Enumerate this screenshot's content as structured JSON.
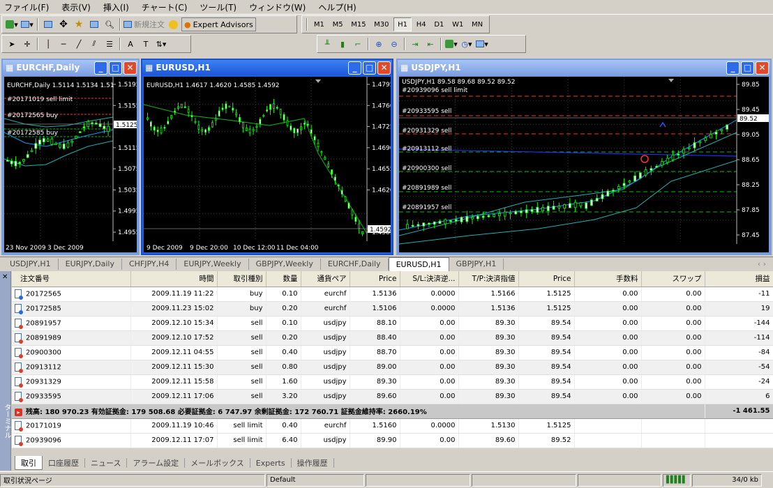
{
  "menu": [
    "ファイル(F)",
    "表示(V)",
    "挿入(I)",
    "チャート(C)",
    "ツール(T)",
    "ウィンドウ(W)",
    "ヘルプ(H)"
  ],
  "toolbar": {
    "new_order": "新規注文",
    "expert_advisors": "Expert Advisors",
    "timeframes": [
      "M1",
      "M5",
      "M15",
      "M30",
      "H1",
      "H4",
      "D1",
      "W1",
      "MN"
    ],
    "active_timeframe": "H1"
  },
  "colors": {
    "bull": "#00ff00",
    "bear": "#ffffff",
    "sell_line": "#ff3030",
    "buy_line": "#00c000",
    "ma": "#00a0ff",
    "band": "#20b0b0"
  },
  "windows": [
    {
      "title": "EURCHF,Daily",
      "info": "EURCHF,Daily  1.5114 1.5134 1.51",
      "orders": [
        "#20171019 sell limit",
        "#20172565 buy",
        "#20172585 buy"
      ],
      "prices": [
        "1.5195",
        "1.5155",
        "1.5125",
        "1.5115",
        "1.5075",
        "1.5035",
        "1.4995",
        "1.4955"
      ],
      "bid": "1.5125",
      "dates": [
        "23 Nov 2009",
        "3 Dec 2009"
      ]
    },
    {
      "title": "EURUSD,H1",
      "info": "EURUSD,H1  1.4617 1.4620 1.4585 1.4592",
      "prices": [
        "1.4795",
        "1.4760",
        "1.4725",
        "1.4690",
        "1.4655",
        "1.4620",
        "1.4592",
        "1.4585"
      ],
      "bid": "1.4592",
      "dates": [
        "9 Dec 2009",
        "9 Dec 20:00",
        "10 Dec 12:00",
        "11 Dec 04:00"
      ]
    },
    {
      "title": "USDJPY,H1",
      "info": "USDJPY,H1  89.58 89.68 89.52 89.52",
      "orders": [
        "#20939096 sell limit",
        "#20933595 sell",
        "#20931329 sell",
        "#20913112 sell",
        "#20900300 sell",
        "#20891989 sell",
        "#20891957 sell"
      ],
      "prices": [
        "89.85",
        "89.45",
        "89.05",
        "88.65",
        "88.25",
        "87.85",
        "87.45"
      ],
      "bid": "89.52"
    }
  ],
  "chart_tabs": [
    "USDJPY,H1",
    "EURJPY,Daily",
    "CHFJPY,H4",
    "EURJPY,Weekly",
    "GBPJPY,Weekly",
    "EURCHF,Daily",
    "EURUSD,H1",
    "GBPJPY,H1"
  ],
  "active_chart_tab": "EURUSD,H1",
  "columns": [
    "注文番号",
    "時間",
    "取引種別",
    "数量",
    "通貨ペア",
    "Price",
    "S/L:決済逆...",
    "T/P:決済指値",
    "Price",
    "手数料",
    "スワップ",
    "損益"
  ],
  "orders": [
    {
      "id": "20172565",
      "time": "2009.11.19 11:22",
      "type": "buy",
      "lots": "0.10",
      "symbol": "eurchf",
      "price": "1.5136",
      "sl": "0.0000",
      "tp": "1.5166",
      "cur": "1.5125",
      "comm": "0.00",
      "swap": "0.00",
      "profit": "-11"
    },
    {
      "id": "20172585",
      "time": "2009.11.23 15:02",
      "type": "buy",
      "lots": "0.20",
      "symbol": "eurchf",
      "price": "1.5106",
      "sl": "0.0000",
      "tp": "1.5136",
      "cur": "1.5125",
      "comm": "0.00",
      "swap": "0.00",
      "profit": "19"
    },
    {
      "id": "20891957",
      "time": "2009.12.10 15:34",
      "type": "sell",
      "lots": "0.10",
      "symbol": "usdjpy",
      "price": "88.10",
      "sl": "0.00",
      "tp": "89.30",
      "cur": "89.54",
      "comm": "0.00",
      "swap": "0.00",
      "profit": "-144"
    },
    {
      "id": "20891989",
      "time": "2009.12.10 17:52",
      "type": "sell",
      "lots": "0.20",
      "symbol": "usdjpy",
      "price": "88.40",
      "sl": "0.00",
      "tp": "89.30",
      "cur": "89.54",
      "comm": "0.00",
      "swap": "0.00",
      "profit": "-114"
    },
    {
      "id": "20900300",
      "time": "2009.12.11 04:55",
      "type": "sell",
      "lots": "0.40",
      "symbol": "usdjpy",
      "price": "88.70",
      "sl": "0.00",
      "tp": "89.30",
      "cur": "89.54",
      "comm": "0.00",
      "swap": "0.00",
      "profit": "-84"
    },
    {
      "id": "20913112",
      "time": "2009.12.11 15:30",
      "type": "sell",
      "lots": "0.80",
      "symbol": "usdjpy",
      "price": "89.00",
      "sl": "0.00",
      "tp": "89.30",
      "cur": "89.54",
      "comm": "0.00",
      "swap": "0.00",
      "profit": "-54"
    },
    {
      "id": "20931329",
      "time": "2009.12.11 15:58",
      "type": "sell",
      "lots": "1.60",
      "symbol": "usdjpy",
      "price": "89.30",
      "sl": "0.00",
      "tp": "89.30",
      "cur": "89.54",
      "comm": "0.00",
      "swap": "0.00",
      "profit": "-24"
    },
    {
      "id": "20933595",
      "time": "2009.12.11 17:06",
      "type": "sell",
      "lots": "3.20",
      "symbol": "usdjpy",
      "price": "89.60",
      "sl": "0.00",
      "tp": "89.30",
      "cur": "89.54",
      "comm": "0.00",
      "swap": "0.00",
      "profit": "6"
    }
  ],
  "summary": {
    "text": "残高: 180 970.23  有効証拠金: 179 508.68  必要証拠金: 6 747.97  余剰証拠金: 172 760.71  証拠金維持率: 2660.19%",
    "total": "-1 461.55"
  },
  "pending": [
    {
      "id": "20171019",
      "time": "2009.11.19 10:46",
      "type": "sell limit",
      "lots": "0.40",
      "symbol": "eurchf",
      "price": "1.5160",
      "sl": "0.0000",
      "tp": "1.5130",
      "cur": "1.5125"
    },
    {
      "id": "20939096",
      "time": "2009.12.11 17:07",
      "type": "sell limit",
      "lots": "6.40",
      "symbol": "usdjpy",
      "price": "89.90",
      "sl": "0.00",
      "tp": "89.60",
      "cur": "89.52"
    }
  ],
  "terminal_label": "ターミナル",
  "terminal_tabs": [
    "取引",
    "口座履歴",
    "ニュース",
    "アラーム設定",
    "メールボックス",
    "Experts",
    "操作履歴"
  ],
  "status": {
    "left": "取引状況ページ",
    "profile": "Default",
    "traffic": "34/0 kb"
  }
}
